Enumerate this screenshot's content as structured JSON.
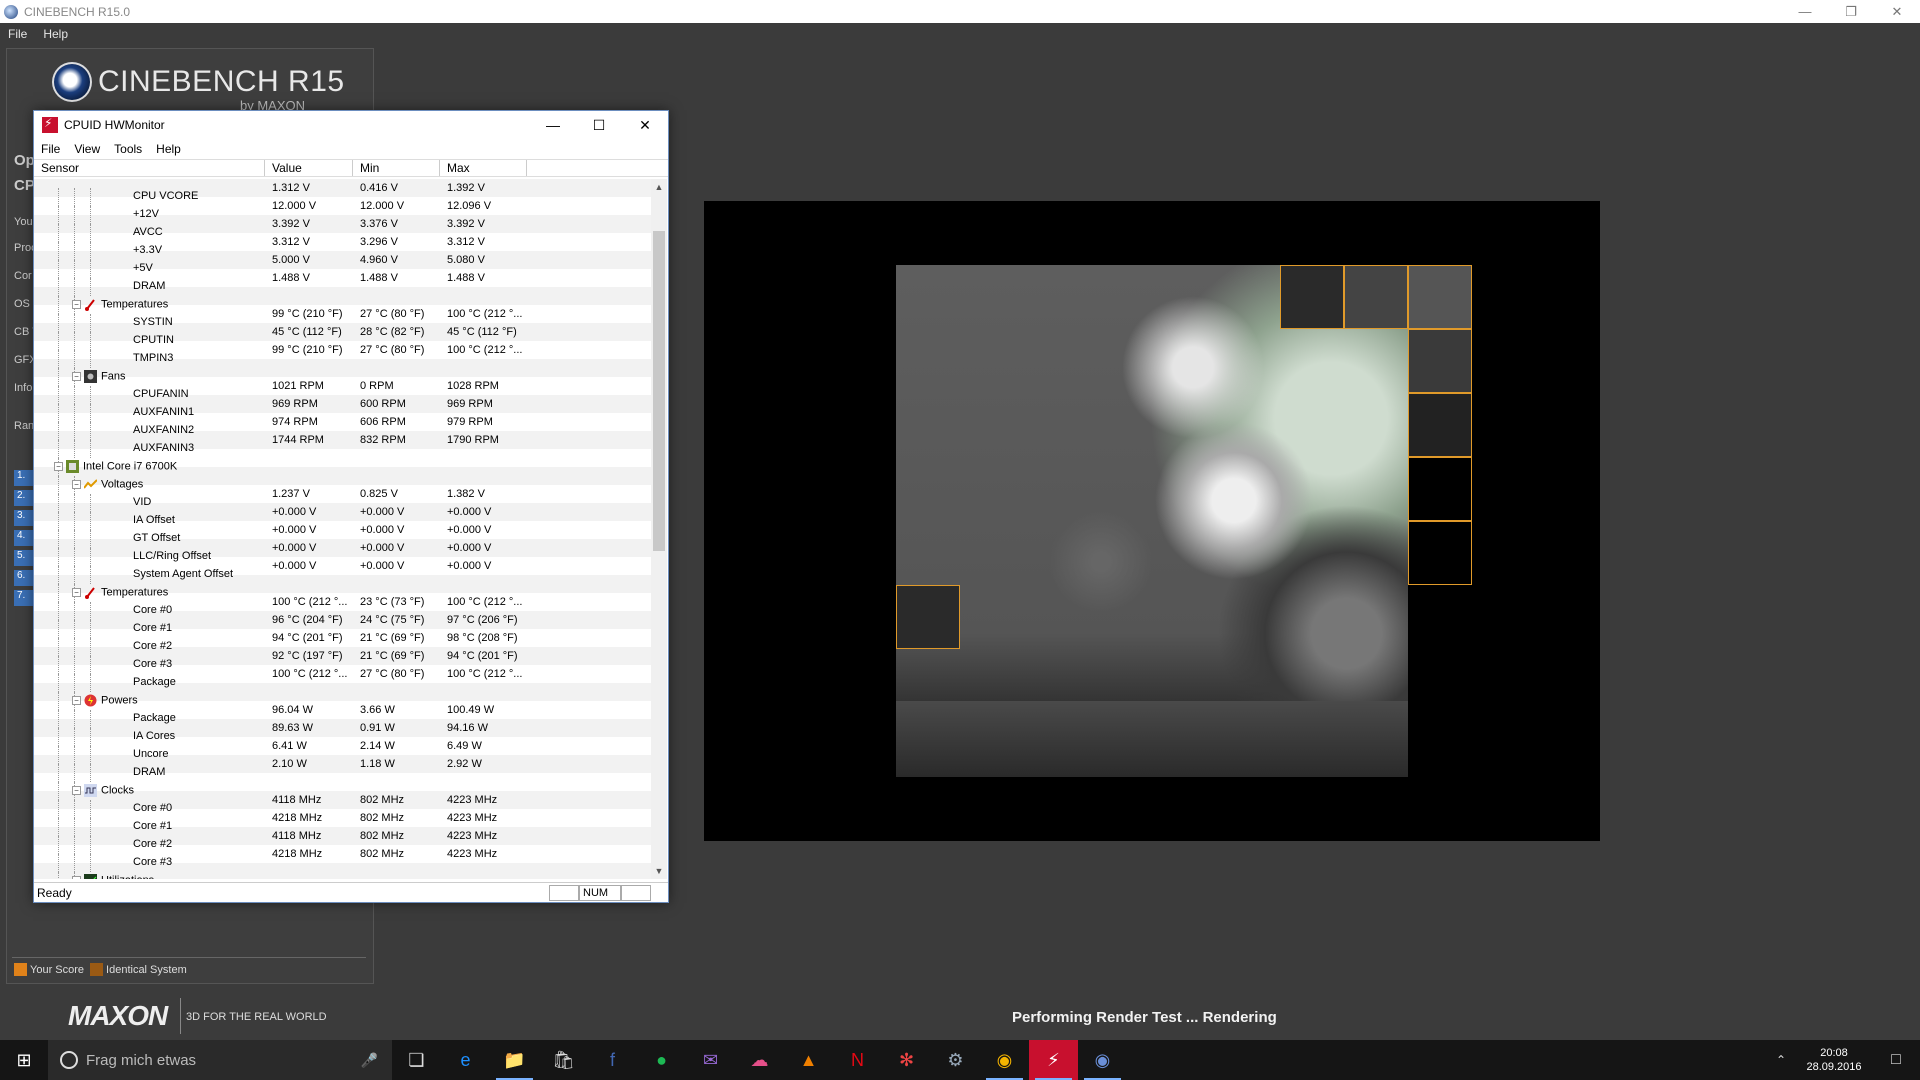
{
  "cinebench": {
    "window_title": "CINEBENCH R15.0",
    "menu": [
      "File",
      "Help"
    ],
    "logo_text": "CINEBENCH R15",
    "logo_sub": "by MAXON",
    "side_labels": [
      "Op",
      "CP",
      "Your",
      "Proc",
      "Cor",
      "OS",
      "CB V",
      "GFX",
      "Info",
      "Rank"
    ],
    "rank_items": [
      "1.",
      "2.",
      "3.",
      "4.",
      "5.",
      "6.",
      "7."
    ],
    "legend": {
      "your_score": "Your Score",
      "identical": "Identical System",
      "your_color": "#e0821a",
      "identical_color": "#9a5a14"
    },
    "footer_logo": "MAXON",
    "footer_slogan": "3D FOR THE REAL WORLD",
    "status": "Performing Render Test ... Rendering"
  },
  "hwmonitor": {
    "title": "CPUID HWMonitor",
    "menu": [
      "File",
      "View",
      "Tools",
      "Help"
    ],
    "columns": [
      "Sensor",
      "Value",
      "Min",
      "Max"
    ],
    "rows": [
      {
        "lvl": 3,
        "name": "CPU VCORE",
        "value": "1.312 V",
        "min": "0.416 V",
        "max": "1.392 V"
      },
      {
        "lvl": 3,
        "name": "+12V",
        "value": "12.000 V",
        "min": "12.000 V",
        "max": "12.096 V"
      },
      {
        "lvl": 3,
        "name": "AVCC",
        "value": "3.392 V",
        "min": "3.376 V",
        "max": "3.392 V"
      },
      {
        "lvl": 3,
        "name": "+3.3V",
        "value": "3.312 V",
        "min": "3.296 V",
        "max": "3.312 V"
      },
      {
        "lvl": 3,
        "name": "+5V",
        "value": "5.000 V",
        "min": "4.960 V",
        "max": "5.080 V"
      },
      {
        "lvl": 3,
        "name": "DRAM",
        "value": "1.488 V",
        "min": "1.488 V",
        "max": "1.488 V"
      },
      {
        "lvl": 2,
        "group": "temp",
        "name": "Temperatures"
      },
      {
        "lvl": 3,
        "name": "SYSTIN",
        "value": "99 °C (210 °F)",
        "min": "27 °C (80 °F)",
        "max": "100 °C (212 °..."
      },
      {
        "lvl": 3,
        "name": "CPUTIN",
        "value": "45 °C (112 °F)",
        "min": "28 °C (82 °F)",
        "max": "45 °C (112 °F)"
      },
      {
        "lvl": 3,
        "name": "TMPIN3",
        "value": "99 °C (210 °F)",
        "min": "27 °C (80 °F)",
        "max": "100 °C (212 °..."
      },
      {
        "lvl": 2,
        "group": "fan",
        "name": "Fans"
      },
      {
        "lvl": 3,
        "name": "CPUFANIN",
        "value": "1021 RPM",
        "min": "0 RPM",
        "max": "1028 RPM"
      },
      {
        "lvl": 3,
        "name": "AUXFANIN1",
        "value": "969 RPM",
        "min": "600 RPM",
        "max": "969 RPM"
      },
      {
        "lvl": 3,
        "name": "AUXFANIN2",
        "value": "974 RPM",
        "min": "606 RPM",
        "max": "979 RPM"
      },
      {
        "lvl": 3,
        "name": "AUXFANIN3",
        "value": "1744 RPM",
        "min": "832 RPM",
        "max": "1790 RPM"
      },
      {
        "lvl": 1,
        "group": "cpu",
        "name": "Intel Core i7 6700K"
      },
      {
        "lvl": 2,
        "group": "volt",
        "name": "Voltages"
      },
      {
        "lvl": 3,
        "name": "VID",
        "value": "1.237 V",
        "min": "0.825 V",
        "max": "1.382 V"
      },
      {
        "lvl": 3,
        "name": "IA Offset",
        "value": "+0.000 V",
        "min": "+0.000 V",
        "max": "+0.000 V"
      },
      {
        "lvl": 3,
        "name": "GT Offset",
        "value": "+0.000 V",
        "min": "+0.000 V",
        "max": "+0.000 V"
      },
      {
        "lvl": 3,
        "name": "LLC/Ring Offset",
        "value": "+0.000 V",
        "min": "+0.000 V",
        "max": "+0.000 V"
      },
      {
        "lvl": 3,
        "name": "System Agent Offset",
        "value": "+0.000 V",
        "min": "+0.000 V",
        "max": "+0.000 V"
      },
      {
        "lvl": 2,
        "group": "temp",
        "name": "Temperatures"
      },
      {
        "lvl": 3,
        "name": "Core #0",
        "value": "100 °C (212 °...",
        "min": "23 °C (73 °F)",
        "max": "100 °C (212 °..."
      },
      {
        "lvl": 3,
        "name": "Core #1",
        "value": "96 °C (204 °F)",
        "min": "24 °C (75 °F)",
        "max": "97 °C (206 °F)"
      },
      {
        "lvl": 3,
        "name": "Core #2",
        "value": "94 °C (201 °F)",
        "min": "21 °C (69 °F)",
        "max": "98 °C (208 °F)"
      },
      {
        "lvl": 3,
        "name": "Core #3",
        "value": "92 °C (197 °F)",
        "min": "21 °C (69 °F)",
        "max": "94 °C (201 °F)"
      },
      {
        "lvl": 3,
        "name": "Package",
        "value": "100 °C (212 °...",
        "min": "27 °C (80 °F)",
        "max": "100 °C (212 °..."
      },
      {
        "lvl": 2,
        "group": "power",
        "name": "Powers"
      },
      {
        "lvl": 3,
        "name": "Package",
        "value": "96.04 W",
        "min": "3.66 W",
        "max": "100.49 W"
      },
      {
        "lvl": 3,
        "name": "IA Cores",
        "value": "89.63 W",
        "min": "0.91 W",
        "max": "94.16 W"
      },
      {
        "lvl": 3,
        "name": "Uncore",
        "value": "6.41 W",
        "min": "2.14 W",
        "max": "6.49 W"
      },
      {
        "lvl": 3,
        "name": "DRAM",
        "value": "2.10 W",
        "min": "1.18 W",
        "max": "2.92 W"
      },
      {
        "lvl": 2,
        "group": "clock",
        "name": "Clocks"
      },
      {
        "lvl": 3,
        "name": "Core #0",
        "value": "4118 MHz",
        "min": "802 MHz",
        "max": "4223 MHz"
      },
      {
        "lvl": 3,
        "name": "Core #1",
        "value": "4218 MHz",
        "min": "802 MHz",
        "max": "4223 MHz"
      },
      {
        "lvl": 3,
        "name": "Core #2",
        "value": "4118 MHz",
        "min": "802 MHz",
        "max": "4223 MHz"
      },
      {
        "lvl": 3,
        "name": "Core #3",
        "value": "4218 MHz",
        "min": "802 MHz",
        "max": "4223 MHz"
      },
      {
        "lvl": 2,
        "group": "util",
        "name": "Utilizations"
      }
    ],
    "status_ready": "Ready",
    "status_num": "NUM"
  },
  "taskbar": {
    "search_placeholder": "Frag mich etwas",
    "time": "20:08",
    "date": "28.09.2016",
    "apps": [
      "task-view",
      "edge",
      "file-explorer",
      "store",
      "facebook",
      "spotify",
      "mail",
      "cloud-app",
      "vlc",
      "netflix",
      "ccleaner",
      "steam",
      "chrome",
      "hwmonitor",
      "cinebench"
    ]
  }
}
